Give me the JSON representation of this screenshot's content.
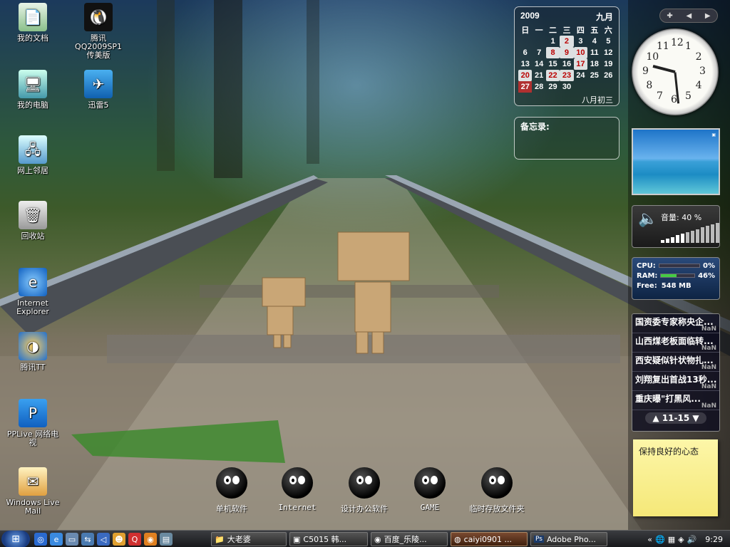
{
  "desktop_icons": [
    {
      "label": "我的文档",
      "icon": "documents-icon"
    },
    {
      "label": "腾讯QQ2009SP1 传美版",
      "icon": "qq-penguin-icon"
    },
    {
      "label": "我的电脑",
      "icon": "computer-icon"
    },
    {
      "label": "迅雷5",
      "icon": "thunder-icon"
    },
    {
      "label": "网上邻居",
      "icon": "network-icon"
    },
    {
      "label": "回收站",
      "icon": "recycle-bin-icon"
    },
    {
      "label": "Internet Explorer",
      "icon": "ie-icon"
    },
    {
      "label": "腾讯TT",
      "icon": "tt-browser-icon"
    },
    {
      "label": "PPLive 网络电视",
      "icon": "pplive-icon"
    },
    {
      "label": "Windows Live Mail",
      "icon": "mail-icon"
    }
  ],
  "quick_folders": [
    {
      "label": "单机软件"
    },
    {
      "label": "Internet"
    },
    {
      "label": "设计办公软件"
    },
    {
      "label": "GAME"
    },
    {
      "label": "临时存放文件夹"
    }
  ],
  "calendar": {
    "year": "2009",
    "month": "九月",
    "weekdays": [
      "日",
      "一",
      "二",
      "三",
      "四",
      "五",
      "六"
    ],
    "weeks": [
      [
        "",
        "",
        "1",
        "2",
        "3",
        "4",
        "5"
      ],
      [
        "6",
        "7",
        "8",
        "9",
        "10",
        "11",
        "12"
      ],
      [
        "13",
        "14",
        "15",
        "16",
        "17",
        "18",
        "19"
      ],
      [
        "20",
        "21",
        "22",
        "23",
        "24",
        "25",
        "26"
      ],
      [
        "27",
        "28",
        "29",
        "30",
        "",
        "",
        ""
      ]
    ],
    "lunar": "八月初三"
  },
  "memo": {
    "title": "备忘录:"
  },
  "clock": {
    "numerals": [
      "12",
      "1",
      "2",
      "3",
      "4",
      "5",
      "6",
      "7",
      "8",
      "9",
      "10",
      "11"
    ],
    "hour": 9,
    "minute": 29
  },
  "volume": {
    "label": "音量: 40 %",
    "level": 0.4
  },
  "system": {
    "cpu_label": "CPU:",
    "cpu_value": "0%",
    "cpu_level": 0,
    "ram_label": "RAM:",
    "ram_value": "46%",
    "ram_level": 0.46,
    "free_label": "Free:",
    "free_value": "548 MB"
  },
  "news": {
    "items": [
      {
        "title": "国资委专家称央企...",
        "tag": "NaN"
      },
      {
        "title": "山西煤老板面临转...",
        "tag": "NaN"
      },
      {
        "title": "西安疑似针状物扎...",
        "tag": "NaN"
      },
      {
        "title": "刘翔复出首战13秒...",
        "tag": "NaN"
      },
      {
        "title": "重庆曝\"打黑风...",
        "tag": "NaN"
      }
    ],
    "pager": "11-15"
  },
  "sticky_note": "保持良好的心态",
  "taskbar": {
    "buttons": [
      {
        "label": "大老婆",
        "active": false
      },
      {
        "label": "C5015 韩...",
        "active": false
      },
      {
        "label": "百度_乐陵...",
        "active": false
      },
      {
        "label": "caiyi0901 ...",
        "active": true
      },
      {
        "label": "Adobe Pho...",
        "active": false
      }
    ],
    "time": "9:29"
  }
}
